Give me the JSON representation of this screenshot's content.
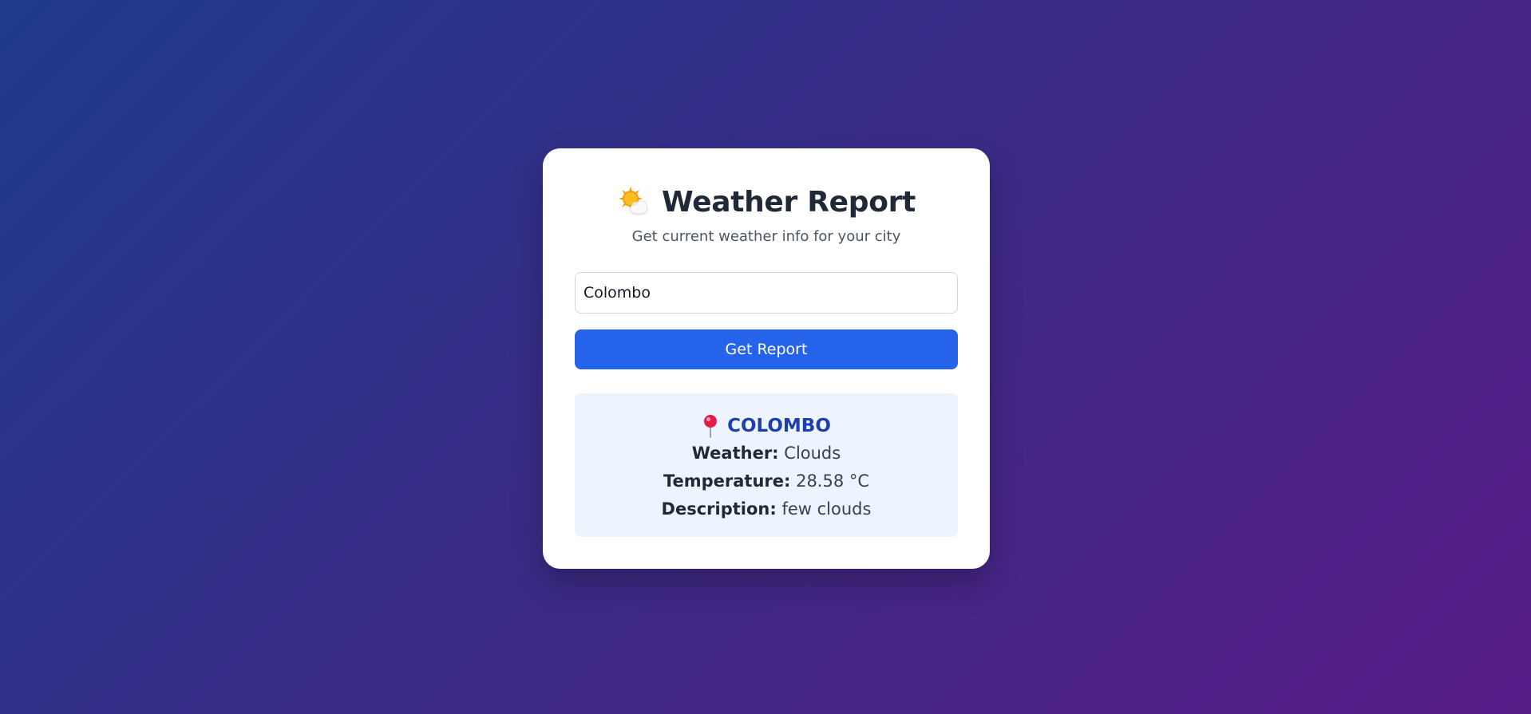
{
  "app": {
    "title": "Weather Report",
    "subtitle": "Get current weather info for your city",
    "title_icon": "sun-behind-cloud-icon"
  },
  "search": {
    "value": "Colombo",
    "placeholder": "Enter city name"
  },
  "button": {
    "label": "Get Report"
  },
  "result": {
    "city": "COLOMBO",
    "city_icon": "round-pushpin-icon",
    "weather_label": "Weather:",
    "weather_value": "Clouds",
    "temperature_label": "Temperature:",
    "temperature_value": "28.58 °C",
    "description_label": "Description:",
    "description_value": "few clouds"
  },
  "colors": {
    "accent": "#2563eb",
    "city": "#1e40af",
    "panel": "#eef4fd",
    "background_start": "#1e3a8a",
    "background_end": "#581c87"
  }
}
